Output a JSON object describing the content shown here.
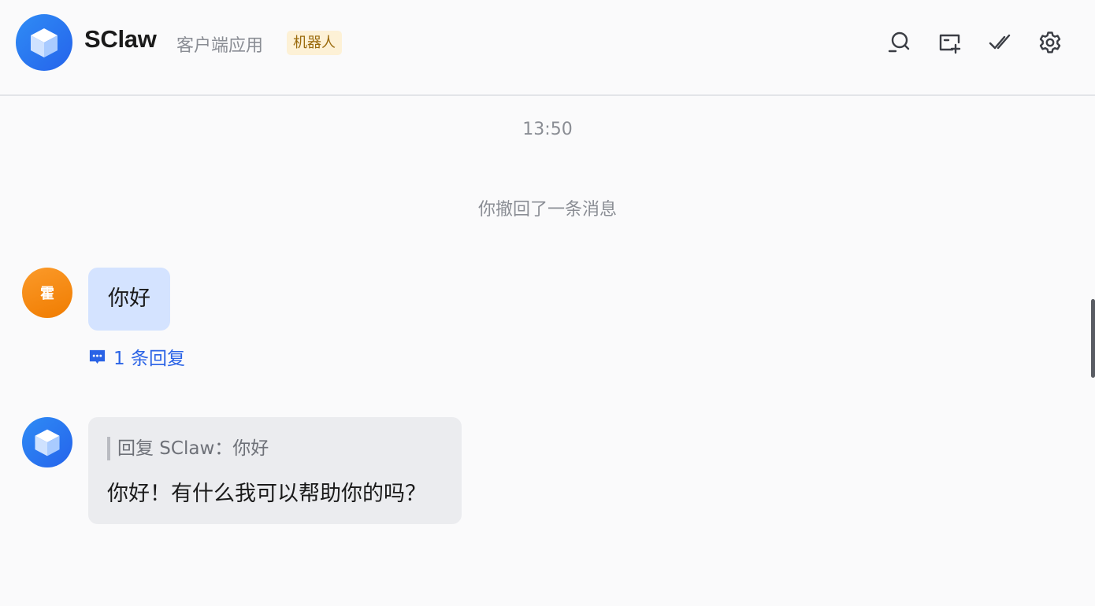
{
  "header": {
    "app_name": "SClaw",
    "app_type": "客户端应用",
    "badge": "机器人",
    "icons": [
      "search-icon",
      "add-topic-icon",
      "mark-done-icon",
      "settings-icon"
    ]
  },
  "timeline": {
    "timestamp": "13:50",
    "recall_notice": "你撤回了一条消息"
  },
  "messages": [
    {
      "sender_initial": "霍",
      "text": "你好",
      "reply_count_label": "1 条回复"
    },
    {
      "quote_label": "回复 SClaw：你好",
      "text": "你好！有什么我可以帮助你的吗？"
    }
  ],
  "colors": {
    "brand_blue": "#2f8cf5",
    "user_bubble": "#d4e3ff",
    "bot_bubble": "#ebecef",
    "link": "#2a63e6",
    "badge_bg": "#fdf1d6",
    "badge_text": "#9a6a0c",
    "avatar_orange": "#f07c00"
  }
}
